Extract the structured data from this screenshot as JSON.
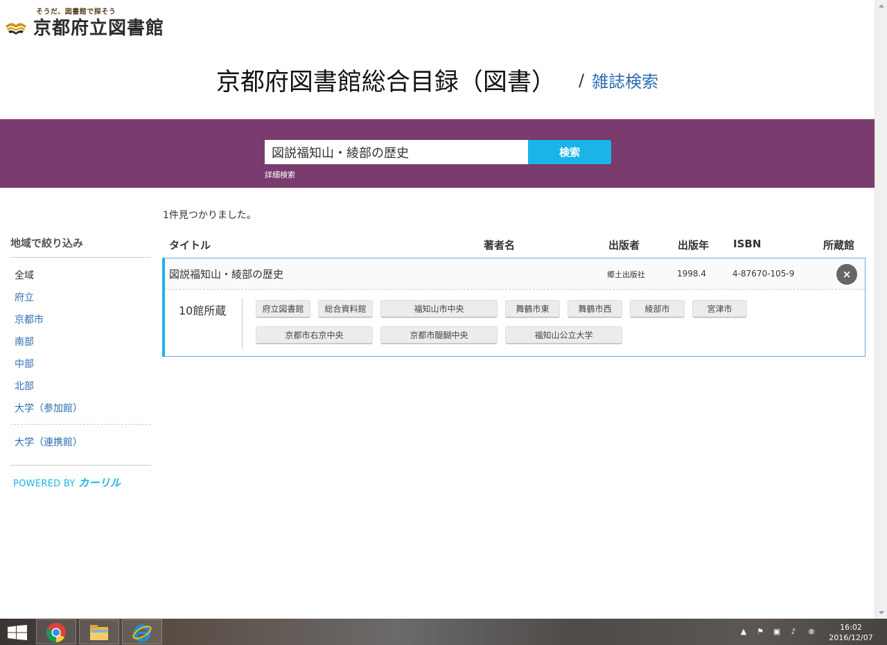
{
  "logo": {
    "tagline": "そうだ、図書館で探そう",
    "name": "京都府立図書館"
  },
  "header": {
    "title": "京都府図書館総合目録（図書）",
    "separator": "/",
    "magazine_link": "雑誌検索"
  },
  "search": {
    "query": "図説福知山・綾部の歴史",
    "button_label": "検索",
    "advanced_link": "詳細検索",
    "band_color": "#7a3b6e",
    "button_color": "#1ab4e8"
  },
  "sidebar": {
    "heading": "地域で絞り込み",
    "regions": [
      "全域",
      "府立",
      "京都市",
      "南部",
      "中部",
      "北部",
      "大学（参加館）"
    ],
    "extra": "大学（連携館）",
    "powered_by": "POWERED BY",
    "powered_brand": "カーリル"
  },
  "results": {
    "count_text": "1件見つかりました。",
    "columns": {
      "title": "タイトル",
      "author": "著者名",
      "publisher": "出版者",
      "year": "出版年",
      "isbn": "ISBN",
      "holding": "所蔵館"
    },
    "items": [
      {
        "title": "図説福知山・綾部の歴史",
        "author": "",
        "publisher": "郷土出版社",
        "year": "1998.4",
        "isbn": "4-87670-105-9",
        "close_label": "×",
        "holdings_count": "10館所蔵",
        "libraries": [
          "府立図書館",
          "総合資料館",
          "福知山市中央",
          "舞鶴市東",
          "舞鶴市西",
          "綾部市",
          "宮津市",
          "京都市右京中央",
          "京都市醍醐中央",
          "福知山公立大学"
        ]
      }
    ]
  },
  "taskbar": {
    "apps": [
      "chrome-icon",
      "file-explorer-icon",
      "internet-explorer-icon"
    ],
    "time": "16:02",
    "date": "2016/12/07"
  }
}
